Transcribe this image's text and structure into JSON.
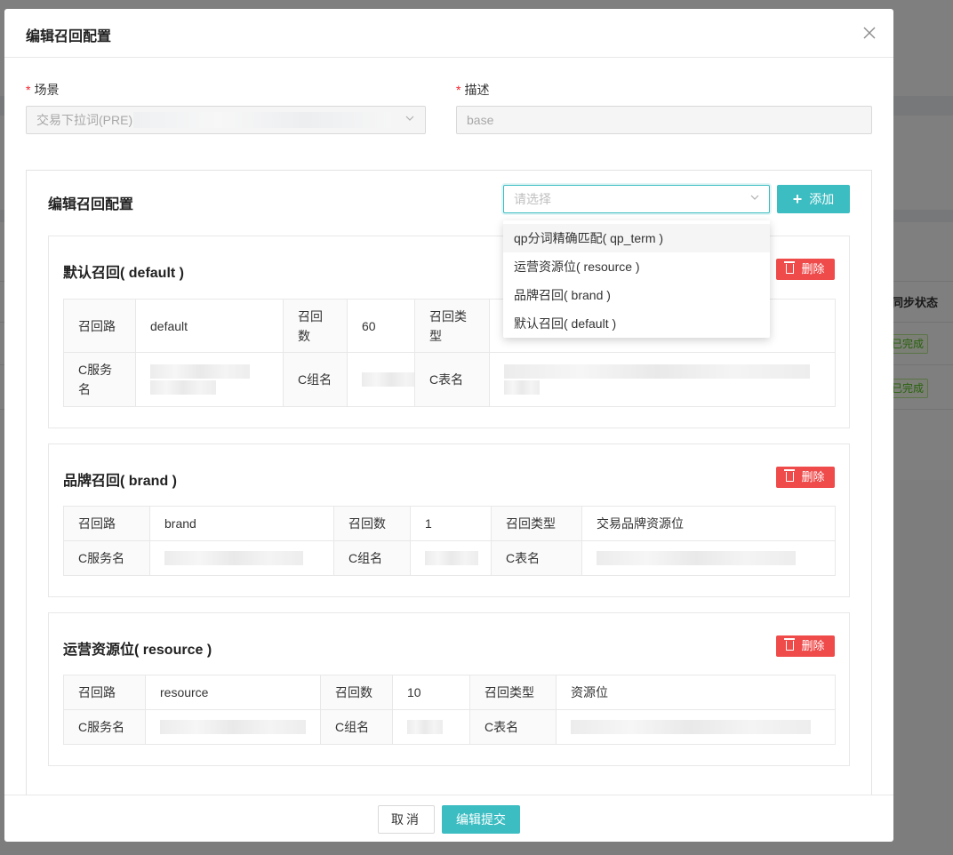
{
  "background": {
    "column_header": "同步状态",
    "status_tags": [
      "已完成",
      "已完成"
    ]
  },
  "modal": {
    "title": "编辑召回配置",
    "close_icon": "close-icon",
    "fields": {
      "scene_label": "场景",
      "scene_value": "交易下拉词(PRE):",
      "desc_label": "描述",
      "desc_value": "base"
    },
    "panel": {
      "title": "编辑召回配置",
      "select_placeholder": "请选择",
      "add_label": "添加"
    },
    "dropdown_options": [
      "qp分词精确匹配( qp_term )",
      "运营资源位( resource )",
      "品牌召回( brand )",
      "默认召回( default )"
    ],
    "cards": [
      {
        "title": "默认召回( default )",
        "delete_label": "删除",
        "row1": {
          "k1": "召回路",
          "v1": "default",
          "k2": "召回数",
          "v2": "60",
          "k3": "召回类型",
          "v3": ""
        },
        "row2": {
          "k1": "C服务名",
          "k2": "C组名",
          "k3": "C表名"
        }
      },
      {
        "title": "品牌召回( brand )",
        "delete_label": "删除",
        "row1": {
          "k1": "召回路",
          "v1": "brand",
          "k2": "召回数",
          "v2": "1",
          "k3": "召回类型",
          "v3": "交易品牌资源位"
        },
        "row2": {
          "k1": "C服务名",
          "k2": "C组名",
          "k3": "C表名"
        }
      },
      {
        "title": "运营资源位( resource )",
        "delete_label": "删除",
        "row1": {
          "k1": "召回路",
          "v1": "resource",
          "k2": "召回数",
          "v2": "10",
          "k3": "召回类型",
          "v3": "资源位"
        },
        "row2": {
          "k1": "C服务名",
          "k2": "C组名",
          "k3": "C表名"
        }
      }
    ],
    "footer": {
      "cancel_label": "取消",
      "submit_label": "编辑提交"
    }
  }
}
